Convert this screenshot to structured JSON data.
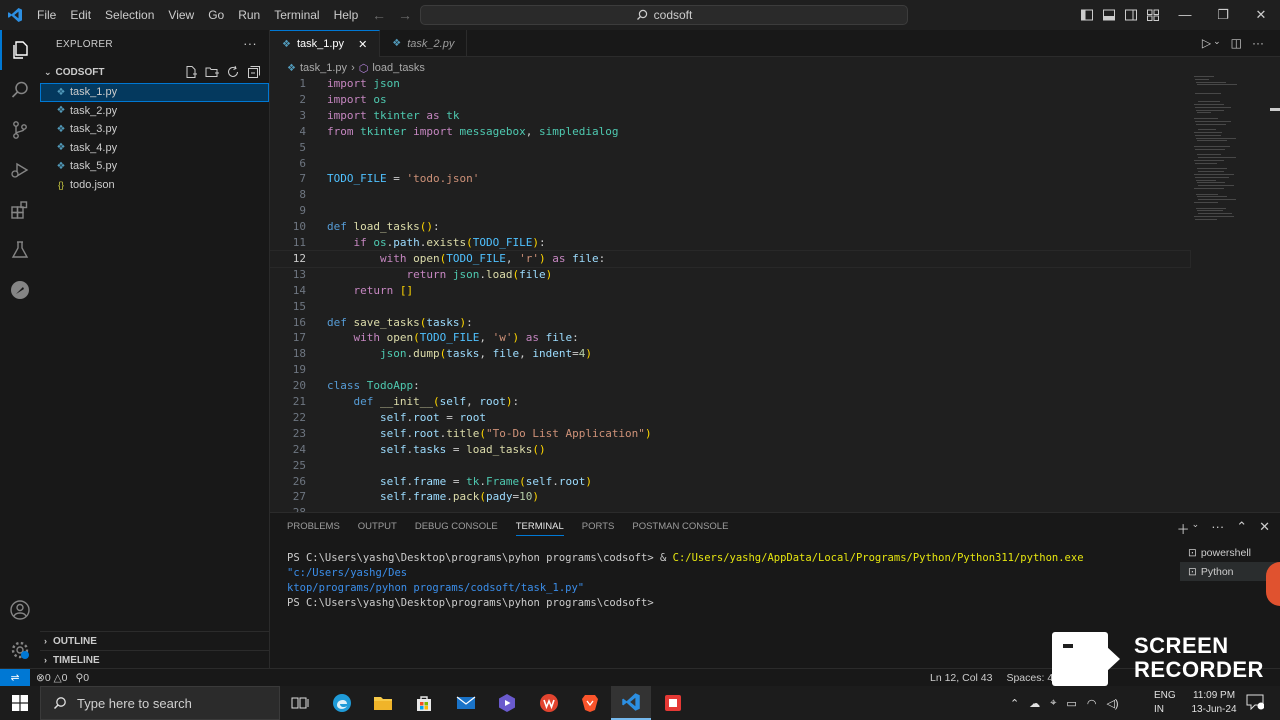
{
  "window": {
    "menu": [
      "File",
      "Edit",
      "Selection",
      "View",
      "Go",
      "Run",
      "Terminal",
      "Help"
    ],
    "search_text": "codsoft"
  },
  "sidebar": {
    "title": "EXPLORER",
    "folder": "CODSOFT",
    "files": [
      {
        "name": "task_1.py",
        "icon": "python-file-icon",
        "selected": true
      },
      {
        "name": "task_2.py",
        "icon": "python-file-icon"
      },
      {
        "name": "task_3.py",
        "icon": "python-file-icon"
      },
      {
        "name": "task_4.py",
        "icon": "python-file-icon"
      },
      {
        "name": "task_5.py",
        "icon": "python-file-icon"
      },
      {
        "name": "todo.json",
        "icon": "json-file-icon"
      }
    ],
    "outline": "OUTLINE",
    "timeline": "TIMELINE"
  },
  "tabs": [
    {
      "label": "task_1.py",
      "active": true
    },
    {
      "label": "task_2.py",
      "active": false
    }
  ],
  "breadcrumb": {
    "file": "task_1.py",
    "symbol": "load_tasks"
  },
  "editor": {
    "current_line": 12,
    "lines": [
      {
        "n": "1",
        "tokens": [
          [
            "kw",
            "import"
          ],
          [
            "plain",
            " "
          ],
          [
            "cls",
            "json"
          ]
        ]
      },
      {
        "n": "2",
        "tokens": [
          [
            "kw",
            "import"
          ],
          [
            "plain",
            " "
          ],
          [
            "cls",
            "os"
          ]
        ]
      },
      {
        "n": "3",
        "tokens": [
          [
            "kw",
            "import"
          ],
          [
            "plain",
            " "
          ],
          [
            "cls",
            "tkinter"
          ],
          [
            "plain",
            " "
          ],
          [
            "kw",
            "as"
          ],
          [
            "plain",
            " "
          ],
          [
            "cls",
            "tk"
          ]
        ]
      },
      {
        "n": "4",
        "tokens": [
          [
            "kw",
            "from"
          ],
          [
            "plain",
            " "
          ],
          [
            "cls",
            "tkinter"
          ],
          [
            "plain",
            " "
          ],
          [
            "kw",
            "import"
          ],
          [
            "plain",
            " "
          ],
          [
            "cls",
            "messagebox"
          ],
          [
            "plain",
            ", "
          ],
          [
            "cls",
            "simpledialog"
          ]
        ]
      },
      {
        "n": "5",
        "tokens": []
      },
      {
        "n": "6",
        "tokens": []
      },
      {
        "n": "7",
        "tokens": [
          [
            "const",
            "TODO_FILE"
          ],
          [
            "plain",
            " = "
          ],
          [
            "str",
            "'todo.json'"
          ]
        ]
      },
      {
        "n": "8",
        "tokens": []
      },
      {
        "n": "9",
        "tokens": []
      },
      {
        "n": "10",
        "tokens": [
          [
            "kwb",
            "def"
          ],
          [
            "plain",
            " "
          ],
          [
            "fn",
            "load_tasks"
          ],
          [
            "br1",
            "()"
          ],
          [
            "plain",
            ":"
          ]
        ]
      },
      {
        "n": "11",
        "tokens": [
          [
            "plain",
            "    "
          ],
          [
            "kw",
            "if"
          ],
          [
            "plain",
            " "
          ],
          [
            "cls",
            "os"
          ],
          [
            "plain",
            "."
          ],
          [
            "var",
            "path"
          ],
          [
            "plain",
            "."
          ],
          [
            "fn",
            "exists"
          ],
          [
            "br1",
            "("
          ],
          [
            "const",
            "TODO_FILE"
          ],
          [
            "br1",
            ")"
          ],
          [
            "plain",
            ":"
          ]
        ]
      },
      {
        "n": "12",
        "tokens": [
          [
            "plain",
            "        "
          ],
          [
            "kw",
            "with"
          ],
          [
            "plain",
            " "
          ],
          [
            "fn",
            "open"
          ],
          [
            "br1",
            "("
          ],
          [
            "const",
            "TODO_FILE"
          ],
          [
            "plain",
            ", "
          ],
          [
            "str",
            "'r'"
          ],
          [
            "br1",
            ")"
          ],
          [
            "plain",
            " "
          ],
          [
            "kw",
            "as"
          ],
          [
            "plain",
            " "
          ],
          [
            "var",
            "file"
          ],
          [
            "plain",
            ":"
          ]
        ]
      },
      {
        "n": "13",
        "tokens": [
          [
            "plain",
            "            "
          ],
          [
            "kw",
            "return"
          ],
          [
            "plain",
            " "
          ],
          [
            "cls",
            "json"
          ],
          [
            "plain",
            "."
          ],
          [
            "fn",
            "load"
          ],
          [
            "br1",
            "("
          ],
          [
            "var",
            "file"
          ],
          [
            "br1",
            ")"
          ]
        ]
      },
      {
        "n": "14",
        "tokens": [
          [
            "plain",
            "    "
          ],
          [
            "kw",
            "return"
          ],
          [
            "plain",
            " "
          ],
          [
            "br1",
            "[]"
          ]
        ]
      },
      {
        "n": "15",
        "tokens": []
      },
      {
        "n": "16",
        "tokens": [
          [
            "kwb",
            "def"
          ],
          [
            "plain",
            " "
          ],
          [
            "fn",
            "save_tasks"
          ],
          [
            "br1",
            "("
          ],
          [
            "var",
            "tasks"
          ],
          [
            "br1",
            ")"
          ],
          [
            "plain",
            ":"
          ]
        ]
      },
      {
        "n": "17",
        "tokens": [
          [
            "plain",
            "    "
          ],
          [
            "kw",
            "with"
          ],
          [
            "plain",
            " "
          ],
          [
            "fn",
            "open"
          ],
          [
            "br1",
            "("
          ],
          [
            "const",
            "TODO_FILE"
          ],
          [
            "plain",
            ", "
          ],
          [
            "str",
            "'w'"
          ],
          [
            "br1",
            ")"
          ],
          [
            "plain",
            " "
          ],
          [
            "kw",
            "as"
          ],
          [
            "plain",
            " "
          ],
          [
            "var",
            "file"
          ],
          [
            "plain",
            ":"
          ]
        ]
      },
      {
        "n": "18",
        "tokens": [
          [
            "plain",
            "        "
          ],
          [
            "cls",
            "json"
          ],
          [
            "plain",
            "."
          ],
          [
            "fn",
            "dump"
          ],
          [
            "br1",
            "("
          ],
          [
            "var",
            "tasks"
          ],
          [
            "plain",
            ", "
          ],
          [
            "var",
            "file"
          ],
          [
            "plain",
            ", "
          ],
          [
            "var",
            "indent"
          ],
          [
            "plain",
            "="
          ],
          [
            "num",
            "4"
          ],
          [
            "br1",
            ")"
          ]
        ]
      },
      {
        "n": "19",
        "tokens": []
      },
      {
        "n": "20",
        "tokens": [
          [
            "kwb",
            "class"
          ],
          [
            "plain",
            " "
          ],
          [
            "cls",
            "TodoApp"
          ],
          [
            "plain",
            ":"
          ]
        ]
      },
      {
        "n": "21",
        "tokens": [
          [
            "plain",
            "    "
          ],
          [
            "kwb",
            "def"
          ],
          [
            "plain",
            " "
          ],
          [
            "fn",
            "__init__"
          ],
          [
            "br1",
            "("
          ],
          [
            "var",
            "self"
          ],
          [
            "plain",
            ", "
          ],
          [
            "var",
            "root"
          ],
          [
            "br1",
            ")"
          ],
          [
            "plain",
            ":"
          ]
        ]
      },
      {
        "n": "22",
        "tokens": [
          [
            "plain",
            "        "
          ],
          [
            "var",
            "self"
          ],
          [
            "plain",
            "."
          ],
          [
            "var",
            "root"
          ],
          [
            "plain",
            " = "
          ],
          [
            "var",
            "root"
          ]
        ]
      },
      {
        "n": "23",
        "tokens": [
          [
            "plain",
            "        "
          ],
          [
            "var",
            "self"
          ],
          [
            "plain",
            "."
          ],
          [
            "var",
            "root"
          ],
          [
            "plain",
            "."
          ],
          [
            "fn",
            "title"
          ],
          [
            "br1",
            "("
          ],
          [
            "str",
            "\"To-Do List Application\""
          ],
          [
            "br1",
            ")"
          ]
        ]
      },
      {
        "n": "24",
        "tokens": [
          [
            "plain",
            "        "
          ],
          [
            "var",
            "self"
          ],
          [
            "plain",
            "."
          ],
          [
            "var",
            "tasks"
          ],
          [
            "plain",
            " = "
          ],
          [
            "fn",
            "load_tasks"
          ],
          [
            "br1",
            "()"
          ]
        ]
      },
      {
        "n": "25",
        "tokens": []
      },
      {
        "n": "26",
        "tokens": [
          [
            "plain",
            "        "
          ],
          [
            "var",
            "self"
          ],
          [
            "plain",
            "."
          ],
          [
            "var",
            "frame"
          ],
          [
            "plain",
            " = "
          ],
          [
            "cls",
            "tk"
          ],
          [
            "plain",
            "."
          ],
          [
            "cls",
            "Frame"
          ],
          [
            "br1",
            "("
          ],
          [
            "var",
            "self"
          ],
          [
            "plain",
            "."
          ],
          [
            "var",
            "root"
          ],
          [
            "br1",
            ")"
          ]
        ]
      },
      {
        "n": "27",
        "tokens": [
          [
            "plain",
            "        "
          ],
          [
            "var",
            "self"
          ],
          [
            "plain",
            "."
          ],
          [
            "var",
            "frame"
          ],
          [
            "plain",
            "."
          ],
          [
            "fn",
            "pack"
          ],
          [
            "br1",
            "("
          ],
          [
            "var",
            "pady"
          ],
          [
            "plain",
            "="
          ],
          [
            "num",
            "10"
          ],
          [
            "br1",
            ")"
          ]
        ]
      },
      {
        "n": "28",
        "tokens": []
      }
    ]
  },
  "panel": {
    "tabs": [
      "PROBLEMS",
      "OUTPUT",
      "DEBUG CONSOLE",
      "TERMINAL",
      "PORTS",
      "POSTMAN CONSOLE"
    ],
    "active_tab": "TERMINAL",
    "terminal_prompt": "PS C:\\Users\\yashg\\Desktop\\programs\\pyhon programs\\codsoft>",
    "terminal_cmd_amp": " & ",
    "terminal_cmd_exe": "C:/Users/yashg/AppData/Local/Programs/Python/Python311/python.exe",
    "terminal_cmd_arg1": " \"c:/Users/yashg/Des",
    "terminal_cmd_arg2": "ktop/programs/pyhon programs/codsoft/task_1.py\"",
    "terminal_prompt2": "PS C:\\Users\\yashg\\Desktop\\programs\\pyhon programs\\codsoft>",
    "terminals": [
      "powershell",
      "Python"
    ]
  },
  "statusbar": {
    "errors": "0",
    "warnings": "0",
    "ports": "0",
    "cursor": "Ln 12, Col 43",
    "spaces": "Spaces: 4"
  },
  "recorder": {
    "line1": "SCREEN",
    "line2": "RECORDER"
  },
  "taskbar": {
    "search_placeholder": "Type here to search",
    "lang1": "ENG",
    "lang2": "IN",
    "time": "11:09 PM",
    "date": "13-Jun-24"
  },
  "colors": {
    "accent": "#0078d4",
    "editor_bg": "#1f1f1f",
    "sidebar_bg": "#181818"
  }
}
